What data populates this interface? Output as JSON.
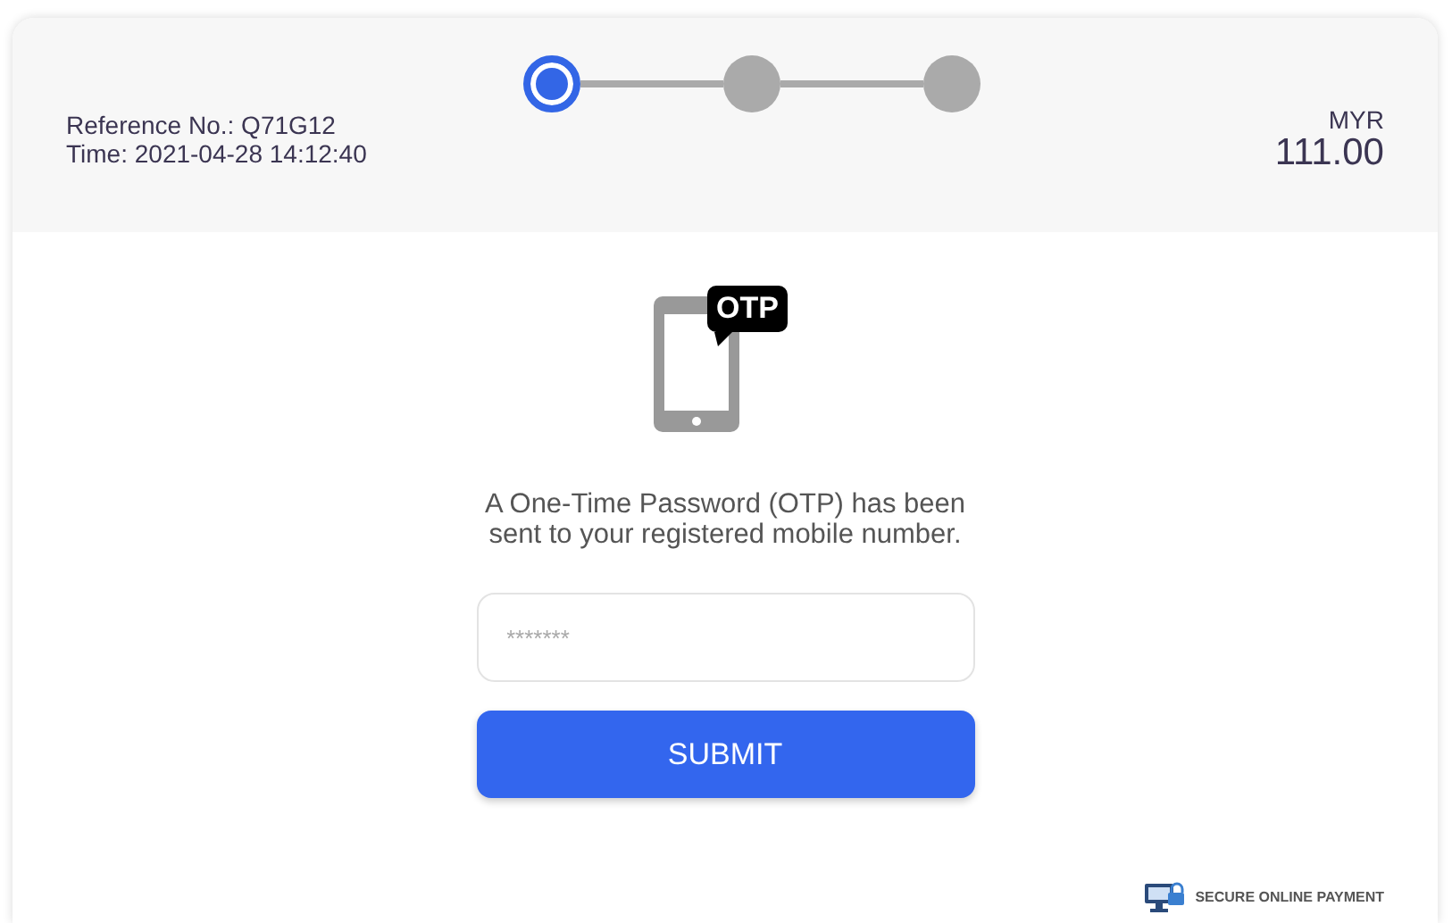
{
  "header": {
    "reference": "Reference No.: Q71G12",
    "time": "Time: 2021-04-28 14:12:40",
    "currency": "MYR",
    "amount": "111.00"
  },
  "steps": [
    {
      "selected": true
    },
    {
      "selected": false
    },
    {
      "selected": false
    }
  ],
  "otp_badge": "OTP",
  "message": "A One-Time Password (OTP) has been sent to your registered mobile number.",
  "otp_field": {
    "placeholder": "*******"
  },
  "submit": "SUBMIT",
  "footer": "SECURE ONLINE PAYMENT"
}
